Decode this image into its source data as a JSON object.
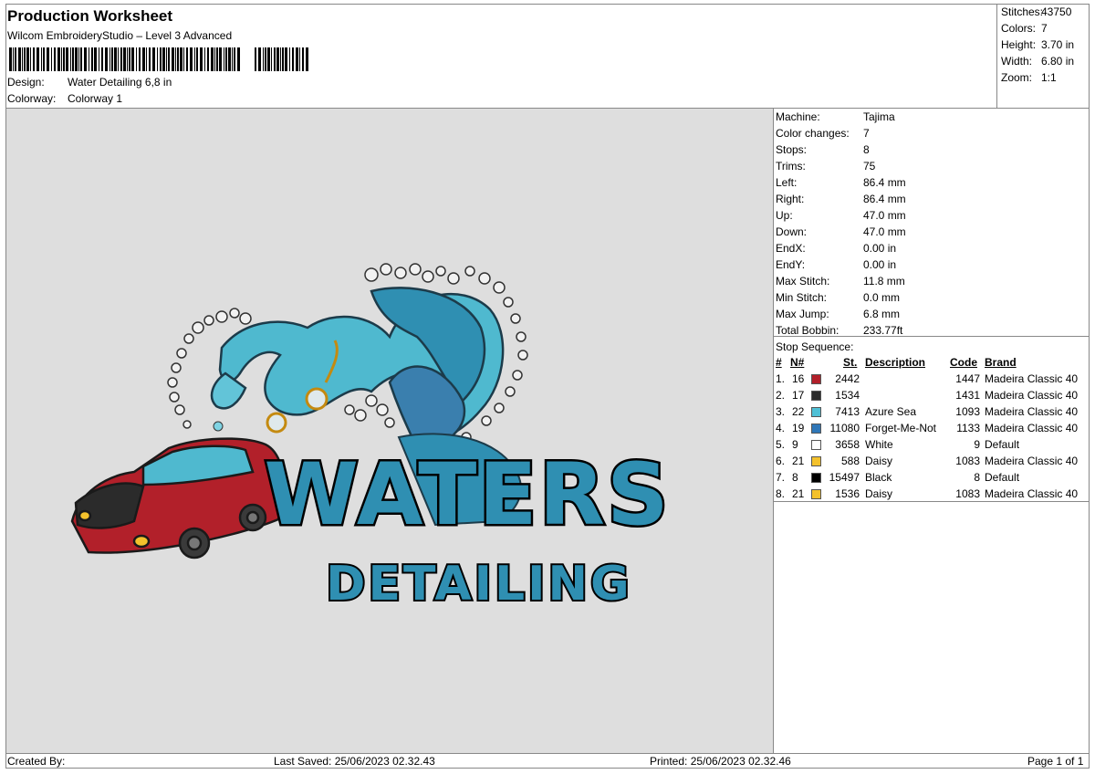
{
  "header": {
    "title": "Production Worksheet",
    "subtitle": "Wilcom EmbroideryStudio – Level 3 Advanced",
    "design_label": "Design:",
    "design_value": "Water Detailing 6,8 in",
    "colorway_label": "Colorway:",
    "colorway_value": "Colorway 1"
  },
  "stats": [
    {
      "label": "Stitches:",
      "value": "43750"
    },
    {
      "label": "Colors:",
      "value": "7"
    },
    {
      "label": "Height:",
      "value": "3.70 in"
    },
    {
      "label": "Width:",
      "value": "6.80 in"
    },
    {
      "label": "Zoom:",
      "value": "1:1"
    }
  ],
  "machine_info": [
    {
      "label": "Machine:",
      "value": "Tajima"
    },
    {
      "label": "Color changes:",
      "value": "7"
    },
    {
      "label": "Stops:",
      "value": "8"
    },
    {
      "label": "Trims:",
      "value": "75"
    },
    {
      "label": "Left:",
      "value": "86.4 mm"
    },
    {
      "label": "Right:",
      "value": "86.4 mm"
    },
    {
      "label": "Up:",
      "value": "47.0 mm"
    },
    {
      "label": "Down:",
      "value": "47.0 mm"
    },
    {
      "label": "EndX:",
      "value": "0.00 in"
    },
    {
      "label": "EndY:",
      "value": "0.00 in"
    },
    {
      "label": "Max Stitch:",
      "value": "11.8 mm"
    },
    {
      "label": "Min Stitch:",
      "value": "0.0 mm"
    },
    {
      "label": "Max Jump:",
      "value": "6.8 mm"
    },
    {
      "label": "Total Bobbin:",
      "value": "233.77ft"
    }
  ],
  "stop_sequence": {
    "title": "Stop Sequence:",
    "headers": {
      "hash": "#",
      "n": "N#",
      "st": "St.",
      "description": "Description",
      "code": "Code",
      "brand": "Brand"
    },
    "rows": [
      {
        "idx": "1.",
        "n": "16",
        "color": "#b2202a",
        "st": "2442",
        "description": "",
        "code": "1447",
        "brand": "Madeira Classic 40"
      },
      {
        "idx": "2.",
        "n": "17",
        "color": "#2b2b2b",
        "st": "1534",
        "description": "",
        "code": "1431",
        "brand": "Madeira Classic 40"
      },
      {
        "idx": "3.",
        "n": "22",
        "color": "#4fc0d6",
        "st": "7413",
        "description": "Azure Sea",
        "code": "1093",
        "brand": "Madeira Classic 40"
      },
      {
        "idx": "4.",
        "n": "19",
        "color": "#2f77b8",
        "st": "11080",
        "description": "Forget-Me-Not",
        "code": "1133",
        "brand": "Madeira Classic 40"
      },
      {
        "idx": "5.",
        "n": "9",
        "color": "#ffffff",
        "st": "3658",
        "description": "White",
        "code": "9",
        "brand": "Default"
      },
      {
        "idx": "6.",
        "n": "21",
        "color": "#f3c12c",
        "st": "588",
        "description": "Daisy",
        "code": "1083",
        "brand": "Madeira Classic 40"
      },
      {
        "idx": "7.",
        "n": "8",
        "color": "#000000",
        "st": "15497",
        "description": "Black",
        "code": "8",
        "brand": "Default"
      },
      {
        "idx": "8.",
        "n": "21",
        "color": "#f3c12c",
        "st": "1536",
        "description": "Daisy",
        "code": "1083",
        "brand": "Madeira Classic 40"
      }
    ]
  },
  "design_art": {
    "line1": "WATERS",
    "line2": "DETAILING"
  },
  "footer": {
    "created_by": "Created By:",
    "last_saved": "Last Saved: 25/06/2023 02.32.43",
    "printed": "Printed: 25/06/2023 02.32.46",
    "page": "Page 1 of 1"
  }
}
